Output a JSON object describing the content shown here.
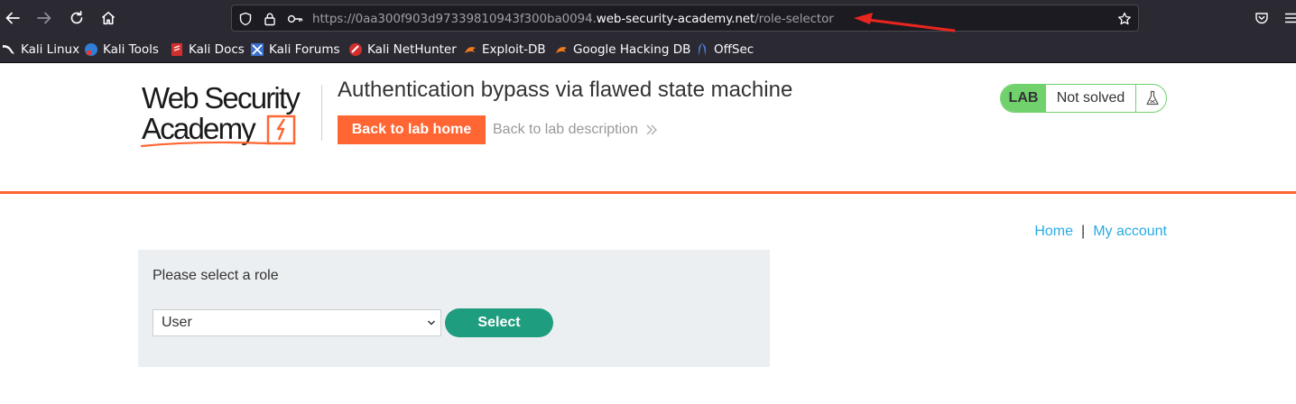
{
  "browser": {
    "url": {
      "scheme": "https://",
      "subdomain": "0aa300f903d97339810943f300ba0094.",
      "host": "web-security-academy.net",
      "path": "/role-selector"
    },
    "bookmarks": [
      {
        "label": "Kali Linux",
        "icon": "kali-dragon-icon"
      },
      {
        "label": "Kali Tools",
        "icon": "kali-tools-icon"
      },
      {
        "label": "Kali Docs",
        "icon": "kali-docs-icon"
      },
      {
        "label": "Kali Forums",
        "icon": "kali-forums-icon"
      },
      {
        "label": "Kali NetHunter",
        "icon": "kali-nethunter-icon"
      },
      {
        "label": "Exploit-DB",
        "icon": "exploit-db-icon"
      },
      {
        "label": "Google Hacking DB",
        "icon": "ghdb-icon"
      },
      {
        "label": "OffSec",
        "icon": "offsec-icon"
      }
    ],
    "colors": {
      "chrome": "#2b2a33",
      "urlbar": "#1c1b22",
      "annotation_arrow": "#e8251f"
    }
  },
  "header": {
    "logo_line1": "Web Security",
    "logo_line2": "Academy",
    "lab_title": "Authentication bypass via flawed state machine",
    "back_home_label": "Back to lab home",
    "back_description_label": "Back to lab description",
    "lab_badge": "LAB",
    "lab_status": "Not solved",
    "colors": {
      "accent": "#ff6633",
      "status_green": "#70d16d"
    }
  },
  "nav": {
    "home_label": "Home",
    "separator": "|",
    "account_label": "My account",
    "link_color": "#29abe2"
  },
  "role_form": {
    "prompt": "Please select a role",
    "selected_role": "User",
    "submit_label": "Select",
    "button_color": "#1f9d7f"
  }
}
